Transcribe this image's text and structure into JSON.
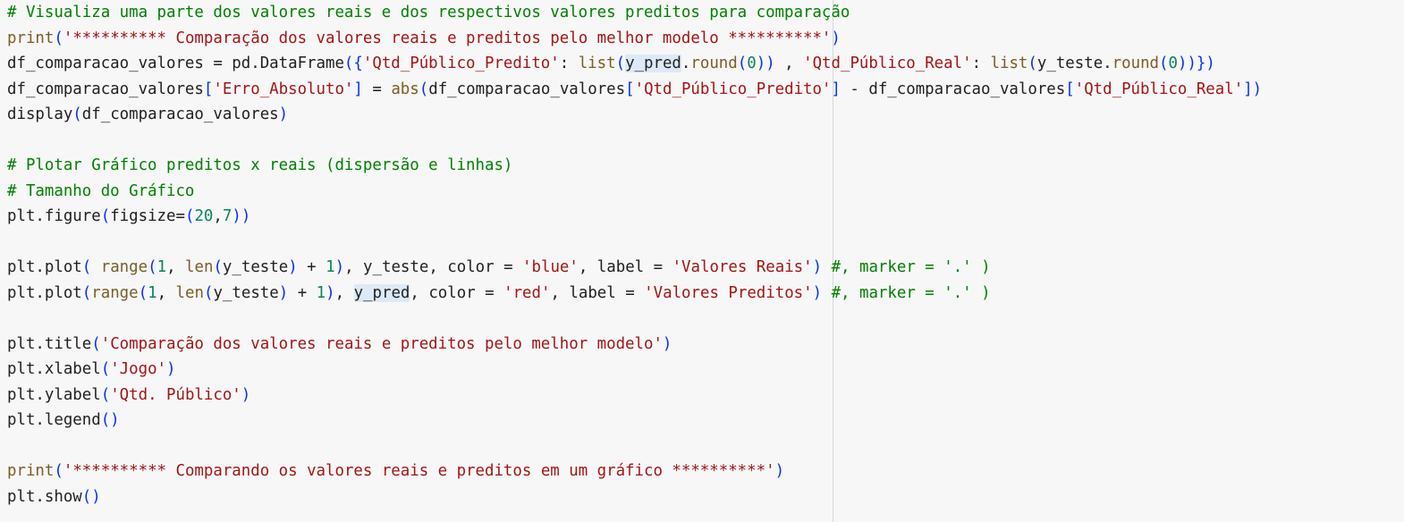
{
  "editor": {
    "lines": [
      [
        {
          "t": "# Visualiza uma parte dos valores reais e dos respectivos valores preditos para comparação",
          "k": "c"
        }
      ],
      [
        {
          "t": "print",
          "k": "f"
        },
        {
          "t": "(",
          "k": "p"
        },
        {
          "t": "'********** Comparação dos valores reais e preditos pelo melhor modelo **********'",
          "k": "s"
        },
        {
          "t": ")",
          "k": "p"
        }
      ],
      [
        {
          "t": "df_comparacao_valores = pd.DataFrame",
          "k": "v"
        },
        {
          "t": "({",
          "k": "p"
        },
        {
          "t": "'Qtd_Público_Predito'",
          "k": "s"
        },
        {
          "t": ": ",
          "k": "v"
        },
        {
          "t": "list",
          "k": "f"
        },
        {
          "t": "(",
          "k": "p"
        },
        {
          "t": "y_pred",
          "k": "v",
          "hl": true
        },
        {
          "t": ".",
          "k": "v"
        },
        {
          "t": "round",
          "k": "f"
        },
        {
          "t": "(",
          "k": "p"
        },
        {
          "t": "0",
          "k": "n"
        },
        {
          "t": "))",
          "k": "p"
        },
        {
          "t": " , ",
          "k": "v"
        },
        {
          "t": "'Qtd_Público_Real'",
          "k": "s"
        },
        {
          "t": ": ",
          "k": "v"
        },
        {
          "t": "list",
          "k": "f"
        },
        {
          "t": "(",
          "k": "p"
        },
        {
          "t": "y_teste.",
          "k": "v"
        },
        {
          "t": "round",
          "k": "f"
        },
        {
          "t": "(",
          "k": "p"
        },
        {
          "t": "0",
          "k": "n"
        },
        {
          "t": "))})",
          "k": "p"
        }
      ],
      [
        {
          "t": "df_comparacao_valores",
          "k": "v"
        },
        {
          "t": "[",
          "k": "p"
        },
        {
          "t": "'Erro_Absoluto'",
          "k": "s"
        },
        {
          "t": "]",
          "k": "p"
        },
        {
          "t": " = ",
          "k": "v"
        },
        {
          "t": "abs",
          "k": "f"
        },
        {
          "t": "(",
          "k": "p"
        },
        {
          "t": "df_comparacao_valores",
          "k": "v"
        },
        {
          "t": "[",
          "k": "p"
        },
        {
          "t": "'Qtd_Público_Predito'",
          "k": "s"
        },
        {
          "t": "]",
          "k": "p"
        },
        {
          "t": " - df_comparacao_valores",
          "k": "v"
        },
        {
          "t": "[",
          "k": "p"
        },
        {
          "t": "'Qtd_Público_Real'",
          "k": "s"
        },
        {
          "t": "])",
          "k": "p"
        }
      ],
      [
        {
          "t": "display",
          "k": "v"
        },
        {
          "t": "(",
          "k": "p"
        },
        {
          "t": "df_comparacao_valores",
          "k": "v"
        },
        {
          "t": ")",
          "k": "p"
        }
      ],
      [],
      [
        {
          "t": "# Plotar Gráfico preditos x reais (dispersão e linhas)",
          "k": "c"
        }
      ],
      [
        {
          "t": "# Tamanho do Gráfico",
          "k": "c"
        }
      ],
      [
        {
          "t": "plt.figure",
          "k": "v"
        },
        {
          "t": "(",
          "k": "p"
        },
        {
          "t": "figsize=",
          "k": "v"
        },
        {
          "t": "(",
          "k": "p"
        },
        {
          "t": "20",
          "k": "n"
        },
        {
          "t": ",",
          "k": "v"
        },
        {
          "t": "7",
          "k": "n"
        },
        {
          "t": "))",
          "k": "p"
        }
      ],
      [],
      [
        {
          "t": "plt.plot",
          "k": "v"
        },
        {
          "t": "(",
          "k": "p"
        },
        {
          "t": " ",
          "k": "v"
        },
        {
          "t": "range",
          "k": "f"
        },
        {
          "t": "(",
          "k": "p"
        },
        {
          "t": "1",
          "k": "n"
        },
        {
          "t": ", ",
          "k": "v"
        },
        {
          "t": "len",
          "k": "f"
        },
        {
          "t": "(",
          "k": "p"
        },
        {
          "t": "y_teste",
          "k": "v"
        },
        {
          "t": ")",
          "k": "p"
        },
        {
          "t": " + ",
          "k": "v"
        },
        {
          "t": "1",
          "k": "n"
        },
        {
          "t": ")",
          "k": "p"
        },
        {
          "t": ", y_teste, color = ",
          "k": "v"
        },
        {
          "t": "'blue'",
          "k": "s"
        },
        {
          "t": ", label = ",
          "k": "v"
        },
        {
          "t": "'Valores Reais'",
          "k": "s"
        },
        {
          "t": ")",
          "k": "p"
        },
        {
          "t": " #, marker = '.' )",
          "k": "c"
        }
      ],
      [
        {
          "t": "plt.plot",
          "k": "v"
        },
        {
          "t": "(",
          "k": "p"
        },
        {
          "t": "range",
          "k": "f"
        },
        {
          "t": "(",
          "k": "p"
        },
        {
          "t": "1",
          "k": "n"
        },
        {
          "t": ", ",
          "k": "v"
        },
        {
          "t": "len",
          "k": "f"
        },
        {
          "t": "(",
          "k": "p"
        },
        {
          "t": "y_teste",
          "k": "v"
        },
        {
          "t": ")",
          "k": "p"
        },
        {
          "t": " + ",
          "k": "v"
        },
        {
          "t": "1",
          "k": "n"
        },
        {
          "t": ")",
          "k": "p"
        },
        {
          "t": ", ",
          "k": "v"
        },
        {
          "t": "y_pred",
          "k": "v",
          "hl": true
        },
        {
          "t": ", color = ",
          "k": "v"
        },
        {
          "t": "'red'",
          "k": "s"
        },
        {
          "t": ", label = ",
          "k": "v"
        },
        {
          "t": "'Valores Preditos'",
          "k": "s"
        },
        {
          "t": ")",
          "k": "p"
        },
        {
          "t": " #, marker = '.' )",
          "k": "c"
        }
      ],
      [],
      [
        {
          "t": "plt.title",
          "k": "v"
        },
        {
          "t": "(",
          "k": "p"
        },
        {
          "t": "'Comparação dos valores reais e preditos pelo melhor modelo'",
          "k": "s"
        },
        {
          "t": ")",
          "k": "p"
        }
      ],
      [
        {
          "t": "plt.xlabel",
          "k": "v"
        },
        {
          "t": "(",
          "k": "p"
        },
        {
          "t": "'Jogo'",
          "k": "s"
        },
        {
          "t": ")",
          "k": "p"
        }
      ],
      [
        {
          "t": "plt.ylabel",
          "k": "v"
        },
        {
          "t": "(",
          "k": "p"
        },
        {
          "t": "'Qtd. Público'",
          "k": "s"
        },
        {
          "t": ")",
          "k": "p"
        }
      ],
      [
        {
          "t": "plt.legend",
          "k": "v"
        },
        {
          "t": "()",
          "k": "p"
        }
      ],
      [],
      [
        {
          "t": "print",
          "k": "f"
        },
        {
          "t": "(",
          "k": "p"
        },
        {
          "t": "'********** Comparando os valores reais e preditos em um gráfico **********'",
          "k": "s"
        },
        {
          "t": ")",
          "k": "p"
        }
      ],
      [
        {
          "t": "plt.show",
          "k": "v"
        },
        {
          "t": "()",
          "k": "p"
        }
      ]
    ]
  }
}
